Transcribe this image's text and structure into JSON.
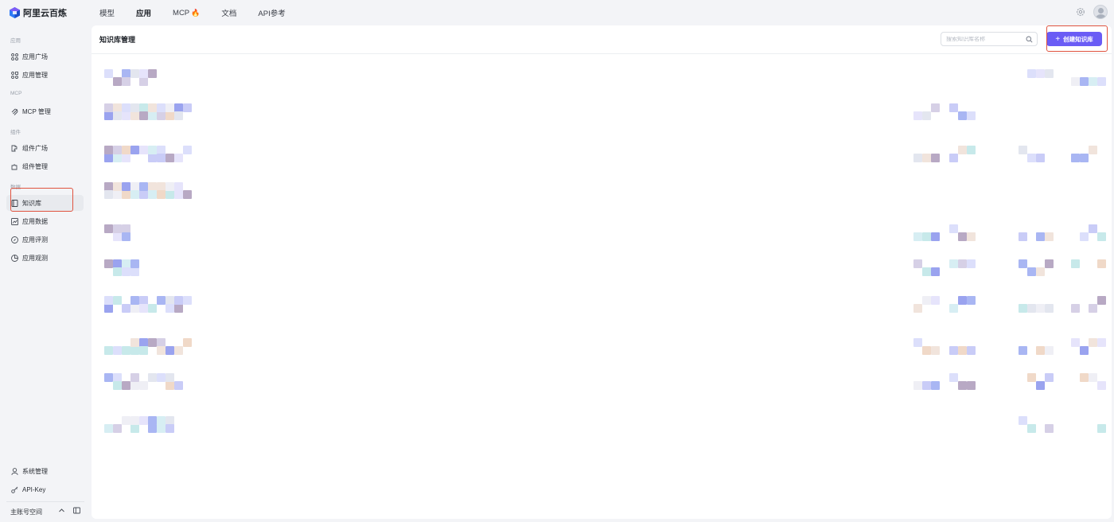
{
  "app": {
    "brand": "阿里云百炼",
    "accent": "#6a5cf5"
  },
  "nav": {
    "items": [
      {
        "label": "模型",
        "active": false
      },
      {
        "label": "应用",
        "active": true
      },
      {
        "label": "MCP",
        "active": false,
        "badge_icon": "fire-icon"
      },
      {
        "label": "文档",
        "active": false
      },
      {
        "label": "API参考",
        "active": false
      }
    ]
  },
  "sidebar": {
    "groups": [
      {
        "label": "应用",
        "items": [
          {
            "label": "应用广场",
            "icon": "grid-icon"
          },
          {
            "label": "应用管理",
            "icon": "grid-icon"
          }
        ]
      },
      {
        "label": "MCP",
        "items": [
          {
            "label": "MCP 管理",
            "icon": "mcp-icon"
          }
        ]
      },
      {
        "label": "组件",
        "items": [
          {
            "label": "组件广场",
            "icon": "component-icon"
          },
          {
            "label": "组件管理",
            "icon": "component-icon"
          }
        ]
      },
      {
        "label": "数据",
        "items": [
          {
            "label": "知识库",
            "icon": "book-icon",
            "active": true
          },
          {
            "label": "应用数据",
            "icon": "chart-icon"
          },
          {
            "label": "应用评测",
            "icon": "compass-icon"
          },
          {
            "label": "应用观测",
            "icon": "pie-icon"
          }
        ]
      }
    ],
    "bottom": [
      {
        "label": "系统管理",
        "icon": "user-icon"
      },
      {
        "label": "API-Key",
        "icon": "key-icon"
      }
    ],
    "workspace": "主账号空间"
  },
  "main": {
    "title": "知识库管理",
    "search_placeholder": "搜索知识库名称",
    "create_label": "创建知识库"
  }
}
